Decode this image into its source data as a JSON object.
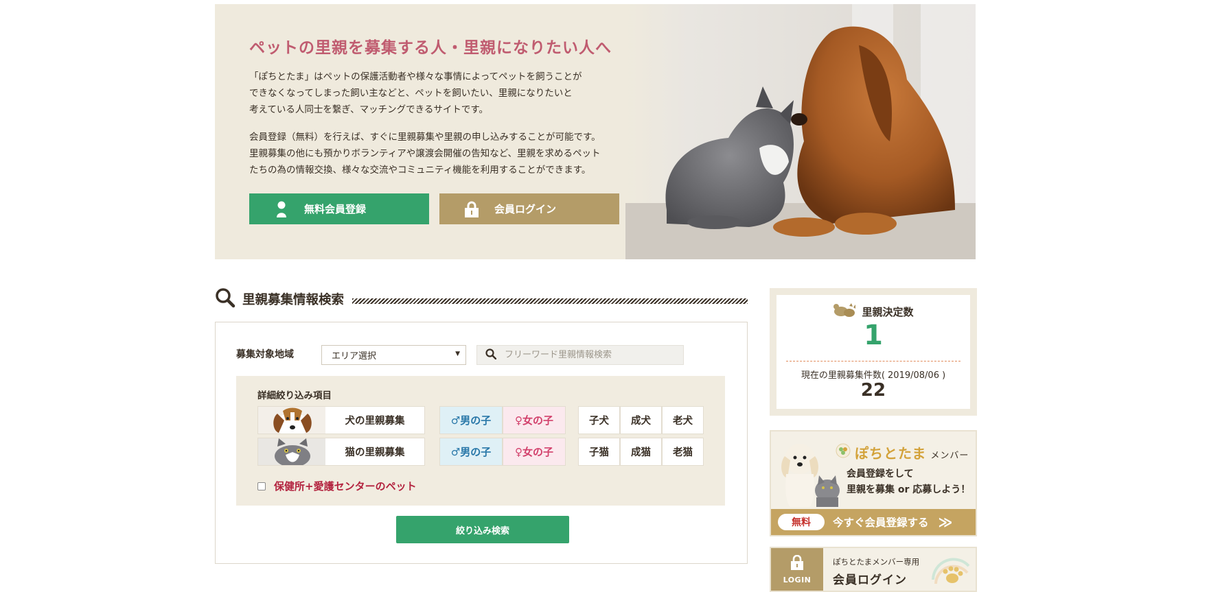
{
  "hero": {
    "title": "ペットの里親を募集する人・里親になりたい人へ",
    "paragraph1": "「ぽちとたま」はペットの保護活動者や様々な事情によってペットを飼うことが\nできなくなってしまった飼い主などと、ペットを飼いたい、里親になりたいと\n考えている人同士を繋ぎ、マッチングできるサイトです。",
    "paragraph2": "会員登録（無料）を行えば、すぐに里親募集や里親の申し込みすることが可能です。\n里親募集の他にも預かりボランティアや譲渡会開催の告知など、里親を求めるペット\nたちの為の情報交換、様々な交流やコミュニティ機能を利用することができます。",
    "register_label": "無料会員登録",
    "login_label": "会員ログイン"
  },
  "search": {
    "title": "里親募集情報検索",
    "area_label": "募集対象地域",
    "area_selected": "エリア選択",
    "free_placeholder": "フリーワード里親情報検索",
    "filter_title": "詳細絞り込み項目",
    "dog_label": "犬の里親募集",
    "cat_label": "猫の里親募集",
    "male_label": "♂男の子",
    "female_label": "♀女の子",
    "dog_ages": [
      "子犬",
      "成犬",
      "老犬"
    ],
    "cat_ages": [
      "子猫",
      "成猫",
      "老猫"
    ],
    "shelter_label": "保健所+愛護センターのペット",
    "submit_label": "絞り込み検索"
  },
  "stats": {
    "decided_label": "里親決定数",
    "decided_count": "1",
    "current_label": "現在の里親募集件数( 2019/08/06 )",
    "current_count": "22"
  },
  "member": {
    "brand": "ぽちとたま",
    "brand_sub": "メンバー",
    "text": "会員登録をして\n里親を募集 or 応募しよう！",
    "free_badge": "無料",
    "cta": "今すぐ会員登録する",
    "arrow": "≫"
  },
  "login": {
    "badge": "LOGIN",
    "sub": "ぽちとたまメンバー専用",
    "main": "会員ログイン"
  },
  "colors": {
    "green": "#35a36c",
    "gold": "#b49c68",
    "pink_title": "#c05c70",
    "beige": "#efeadd"
  }
}
